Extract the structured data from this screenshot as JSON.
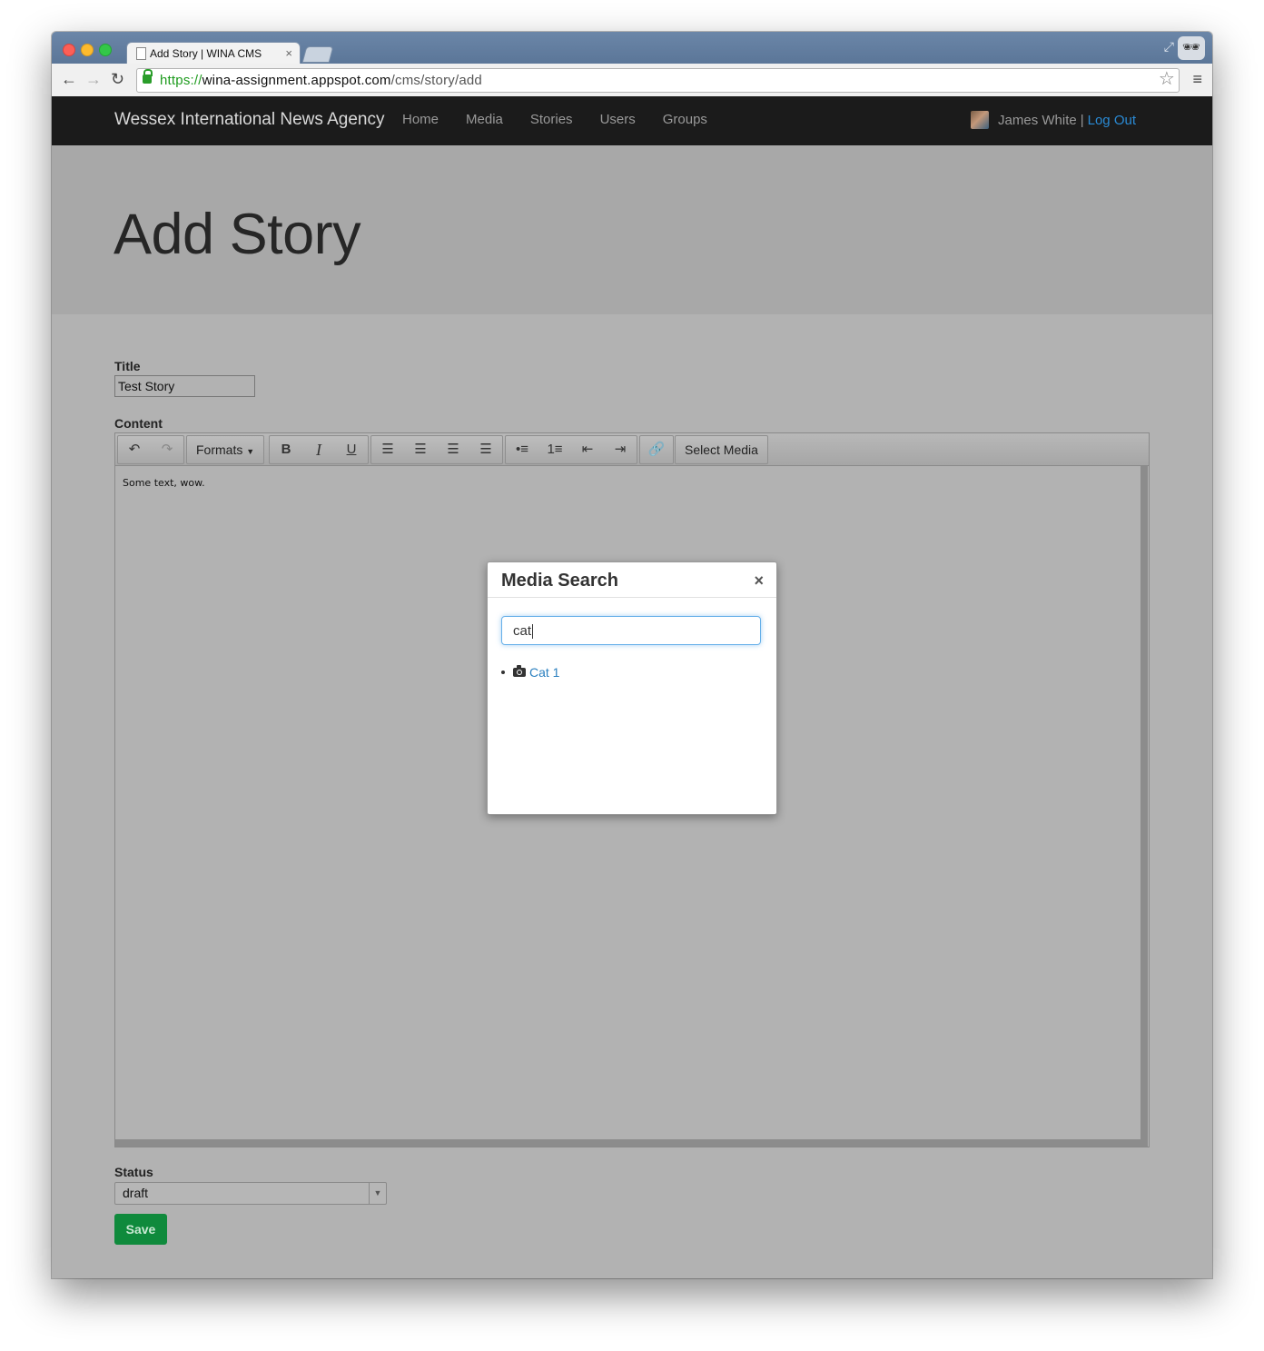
{
  "browser": {
    "tab_title": "Add Story | WINA CMS",
    "tab_close": "×",
    "url_scheme": "https://",
    "url_host": "wina-assignment.appspot.com",
    "url_path": "/cms/story/add"
  },
  "nav": {
    "brand": "Wessex International News Agency",
    "links": [
      "Home",
      "Media",
      "Stories",
      "Users",
      "Groups"
    ],
    "user_name": "James White",
    "separator": "|",
    "logout": "Log Out"
  },
  "page": {
    "title": "Add Story"
  },
  "form": {
    "title_label": "Title",
    "title_value": "Test Story",
    "content_label": "Content",
    "content_text": "Some text, wow.",
    "status_label": "Status",
    "status_value": "draft",
    "save_label": "Save"
  },
  "editor_toolbar": {
    "formats_label": "Formats",
    "select_media_label": "Select Media",
    "icons": [
      "undo-icon",
      "redo-icon",
      "bold-icon",
      "italic-icon",
      "underline-icon",
      "align-left-icon",
      "align-center-icon",
      "align-right-icon",
      "align-justify-icon",
      "bullet-list-icon",
      "numbered-list-icon",
      "outdent-icon",
      "indent-icon",
      "link-icon"
    ]
  },
  "modal": {
    "title": "Media Search",
    "close": "×",
    "search_value": "cat",
    "results": [
      "Cat 1"
    ]
  }
}
